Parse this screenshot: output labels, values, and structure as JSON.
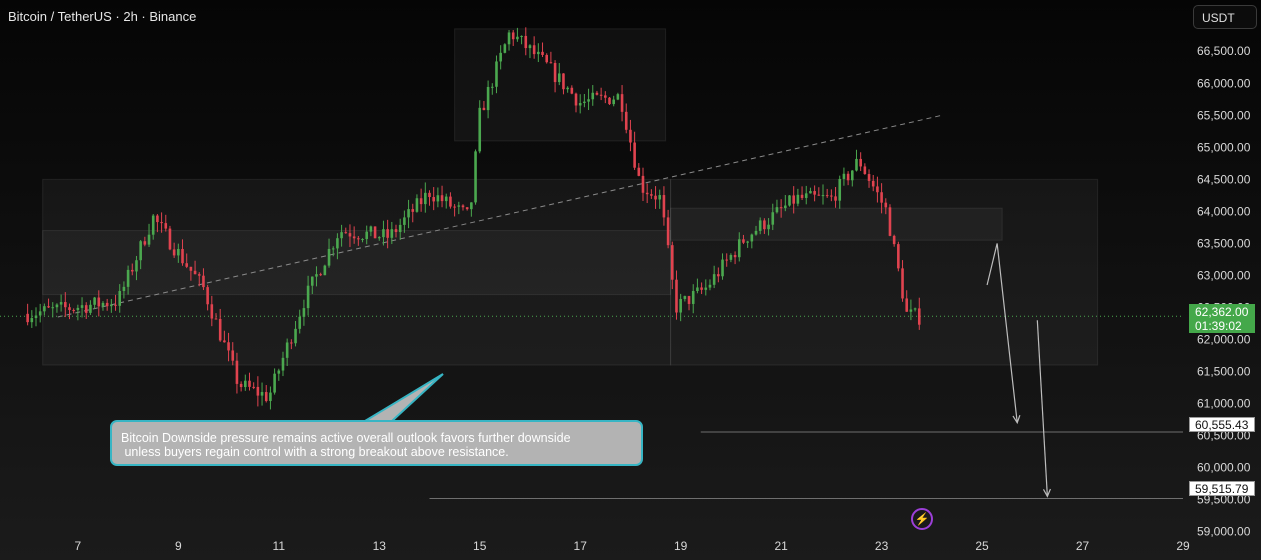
{
  "header": {
    "title": "Bitcoin / TetherUS · 2h · Binance",
    "currency_button": "USDT"
  },
  "callout": {
    "text": "Bitcoin Downside pressure remains active overall outlook favors further downside\n unless buyers regain control with a strong breakout above resistance."
  },
  "current_price": {
    "value": "62,362.00",
    "countdown": "01:39:02"
  },
  "target_levels": [
    {
      "label": "60,555.43",
      "value": 60555.43
    },
    {
      "label": "59,515.79",
      "value": 59515.79
    }
  ],
  "colors": {
    "up": "#4ba84f",
    "down": "#e0434f",
    "current_price_bg": "#44a84a",
    "callout_border": "#37b5c4",
    "alert_icon": "#9c3fd8"
  },
  "alert_icon": "lightning-icon",
  "chart_data": {
    "type": "candlestick",
    "title": "Bitcoin / TetherUS · 2h · Binance",
    "xlabel": "",
    "ylabel": "",
    "x_ticks": [
      "7",
      "9",
      "11",
      "13",
      "15",
      "17",
      "19",
      "21",
      "23",
      "25",
      "27",
      "29"
    ],
    "y_ticks": [
      "59,000.00",
      "59,500.00",
      "60,000.00",
      "60,500.00",
      "61,000.00",
      "61,500.00",
      "62,000.00",
      "62,500.00",
      "63,000.00",
      "63,500.00",
      "64,000.00",
      "64,500.00",
      "65,000.00",
      "65,500.00",
      "66,000.00",
      "66,500.00"
    ],
    "ylim": [
      58900,
      67300
    ],
    "xlim": [
      5.45,
      29.0
    ],
    "grid": false,
    "trend_points": [
      {
        "x": 6.0,
        "y": 62400
      },
      {
        "x": 7.8,
        "y": 62600
      },
      {
        "x": 8.5,
        "y": 63900
      },
      {
        "x": 9.5,
        "y": 62800
      },
      {
        "x": 10.2,
        "y": 61300
      },
      {
        "x": 10.8,
        "y": 61100
      },
      {
        "x": 11.5,
        "y": 62600
      },
      {
        "x": 12.2,
        "y": 63700
      },
      {
        "x": 13.2,
        "y": 63600
      },
      {
        "x": 14.0,
        "y": 64300
      },
      {
        "x": 14.8,
        "y": 63900
      },
      {
        "x": 15.0,
        "y": 65500
      },
      {
        "x": 15.6,
        "y": 66800
      },
      {
        "x": 16.3,
        "y": 66300
      },
      {
        "x": 17.0,
        "y": 65700
      },
      {
        "x": 17.8,
        "y": 65800
      },
      {
        "x": 18.2,
        "y": 64400
      },
      {
        "x": 18.6,
        "y": 64200
      },
      {
        "x": 18.9,
        "y": 62500
      },
      {
        "x": 19.5,
        "y": 62800
      },
      {
        "x": 20.3,
        "y": 63600
      },
      {
        "x": 21.3,
        "y": 64200
      },
      {
        "x": 22.0,
        "y": 64200
      },
      {
        "x": 22.55,
        "y": 64800
      },
      {
        "x": 23.1,
        "y": 64000
      },
      {
        "x": 23.5,
        "y": 62400
      },
      {
        "x": 23.75,
        "y": 62350
      }
    ],
    "zones": [
      {
        "x0": 6.3,
        "x1": 18.8,
        "y0": 62700,
        "y1": 63700
      },
      {
        "x0": 6.3,
        "x1": 18.8,
        "y0": 61600,
        "y1": 64500
      },
      {
        "x0": 18.8,
        "x1": 27.3,
        "y0": 61600,
        "y1": 64500
      },
      {
        "x0": 14.5,
        "x1": 18.7,
        "y0": 65100,
        "y1": 66850
      },
      {
        "x0": 18.8,
        "x1": 25.4,
        "y0": 63550,
        "y1": 64050
      }
    ],
    "trendline": {
      "x0": 6.6,
      "x1": 24.2,
      "y0": 62350,
      "y1": 65500,
      "x2": 24.2,
      "y2": 65500
    },
    "horizontal_levels": [
      {
        "value": 60555.43,
        "x_start": 19.4
      },
      {
        "value": 59515.79,
        "x_start": 14.0
      }
    ],
    "projection_paths": [
      [
        {
          "x": 25.1,
          "y": 62850
        },
        {
          "x": 25.3,
          "y": 63500
        },
        {
          "x": 25.7,
          "y": 60700
        }
      ],
      [
        {
          "x": 26.1,
          "y": 62300
        },
        {
          "x": 26.3,
          "y": 59550
        }
      ]
    ]
  }
}
